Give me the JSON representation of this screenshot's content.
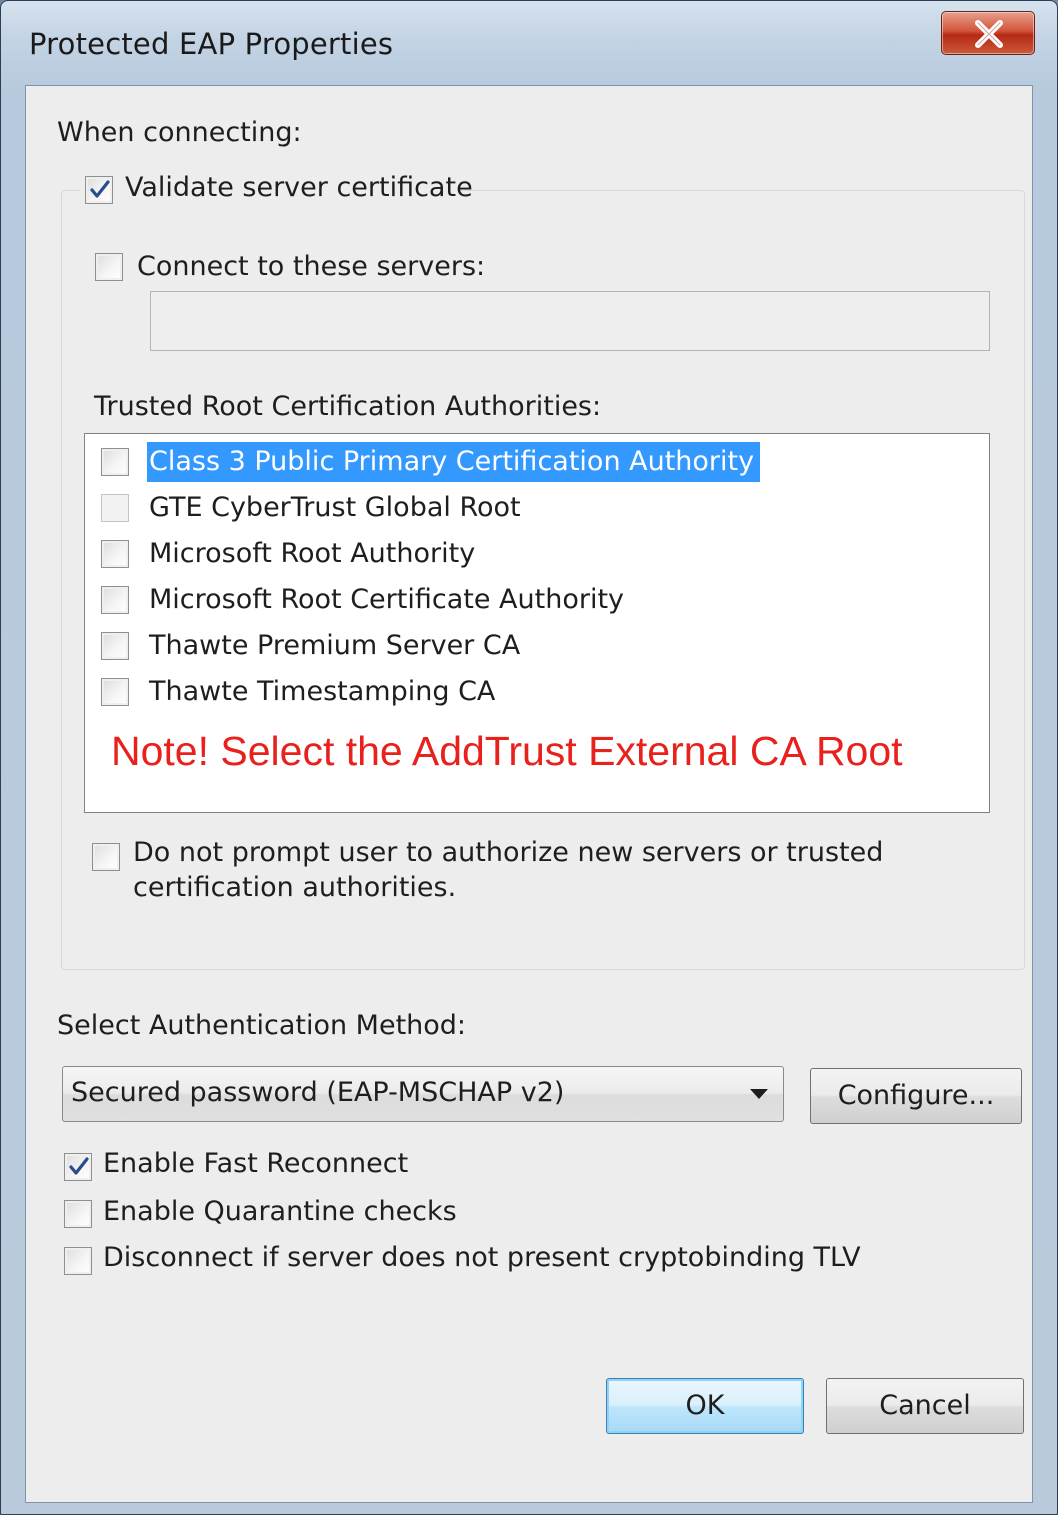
{
  "window": {
    "title": "Protected EAP Properties",
    "close_symbol": "X"
  },
  "when_connecting_label": "When connecting:",
  "validate_server_certificate": {
    "label": "Validate server certificate",
    "checked": true
  },
  "connect_to_servers": {
    "label": "Connect to these servers:",
    "checked": false,
    "value": ""
  },
  "trusted_roots": {
    "label": "Trusted Root Certification Authorities:",
    "items": [
      {
        "label": "Class 3 Public Primary Certification Authority",
        "checked": false,
        "selected": true
      },
      {
        "label": "GTE CyberTrust Global Root",
        "checked": false,
        "selected": false,
        "disabled": true
      },
      {
        "label": "Microsoft Root Authority",
        "checked": false,
        "selected": false
      },
      {
        "label": "Microsoft Root Certificate Authority",
        "checked": false,
        "selected": false
      },
      {
        "label": "Thawte Premium Server CA",
        "checked": false,
        "selected": false
      },
      {
        "label": "Thawte Timestamping CA",
        "checked": false,
        "selected": false
      }
    ],
    "note": "Note! Select the AddTrust External CA Root",
    "note_color": "#e8211d"
  },
  "do_not_prompt": {
    "label_line1": "Do not prompt user to authorize new servers or trusted",
    "label_line2": "certification authorities.",
    "checked": false
  },
  "auth_method": {
    "label": "Select Authentication Method:",
    "selected": "Secured password (EAP-MSCHAP v2)",
    "configure_label": "Configure..."
  },
  "options": [
    {
      "label": "Enable Fast Reconnect",
      "checked": true
    },
    {
      "label": "Enable Quarantine checks",
      "checked": false
    },
    {
      "label": "Disconnect if server does not present cryptobinding TLV",
      "checked": false
    }
  ],
  "buttons": {
    "ok": "OK",
    "cancel": "Cancel"
  },
  "colors": {
    "selection": "#3399ff",
    "close_button": "#c8442a",
    "check_mark": "#2a4c8c"
  },
  "icons": {
    "close": "close-icon",
    "dropdown": "chevron-down-icon",
    "check": "checkmark-icon"
  }
}
